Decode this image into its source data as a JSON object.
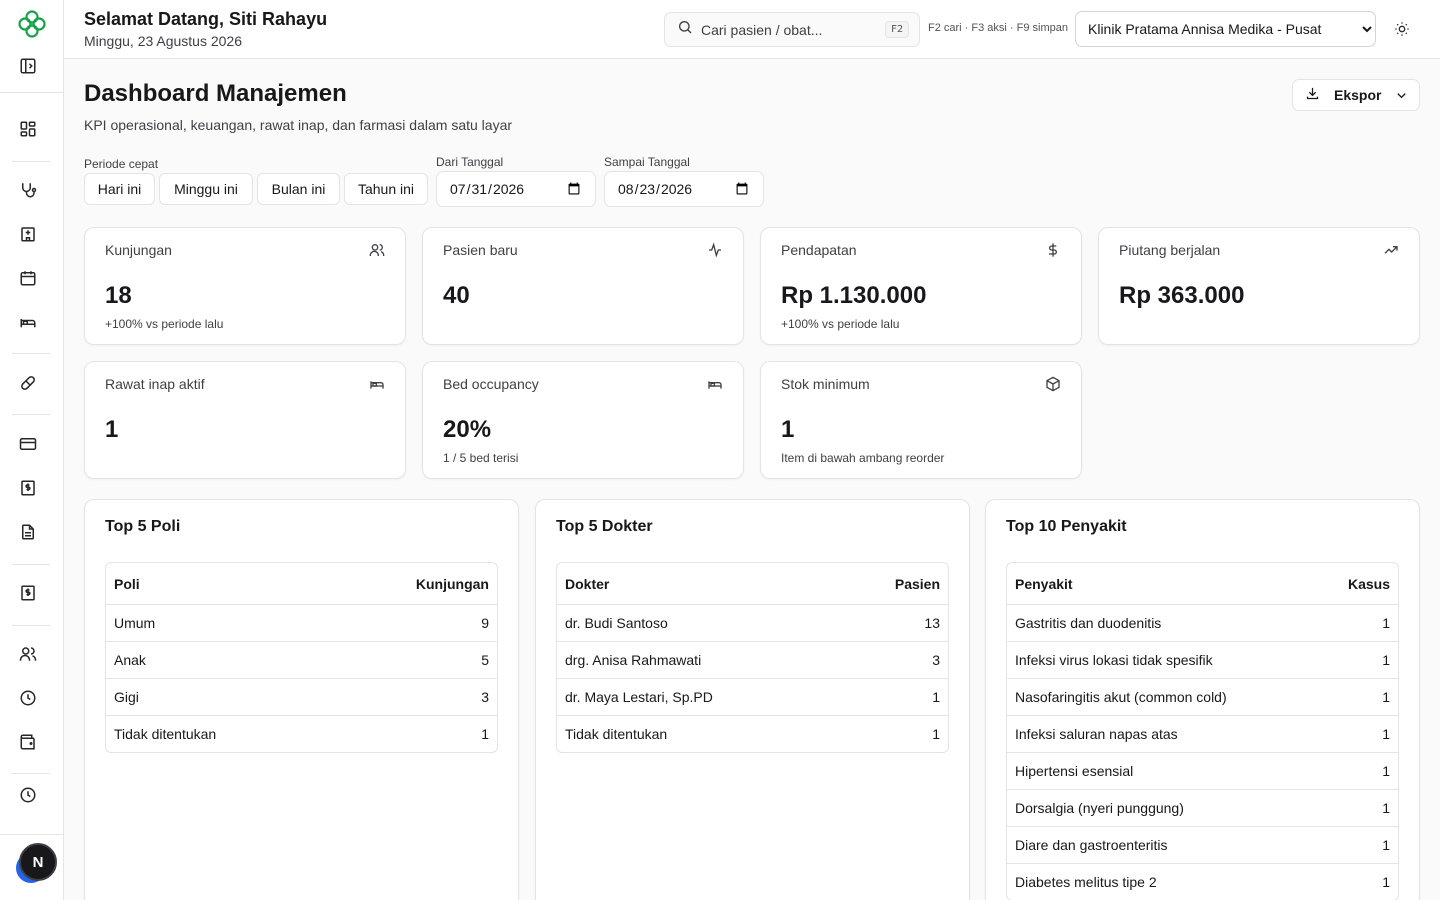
{
  "header": {
    "greeting": "Selamat Datang, Siti Rahayu",
    "date": "Minggu, 23 Agustus 2026",
    "search_placeholder": "Cari pasien / obat...",
    "search_kbd": "F2",
    "shortcuts": "F2 cari · F3 aksi · F9 simpan",
    "clinic_selected": "Klinik Pratama Annisa Medika - Pusat"
  },
  "sidebar": {
    "avatar_letter": "N",
    "icons": [
      "logo-icon",
      "sidebar-toggle-icon",
      "dashboard-icon",
      "stethoscope-icon",
      "hospital-icon",
      "calendar-icon",
      "bed-icon",
      "pill-icon",
      "credit-card-icon",
      "receipt-icon",
      "file-text-icon",
      "dollar-receipt-icon",
      "users-icon",
      "clock-icon",
      "wallet-icon",
      "history-icon"
    ]
  },
  "page": {
    "title": "Dashboard Manajemen",
    "subtitle": "KPI operasional, keuangan, rawat inap, dan farmasi dalam satu layar",
    "export_label": "Ekspor"
  },
  "filters": {
    "quick_label": "Periode cepat",
    "quick": [
      "Hari ini",
      "Minggu ini",
      "Bulan ini",
      "Tahun ini"
    ],
    "from_label": "Dari Tanggal",
    "from_value": "2026-07-31",
    "to_label": "Sampai Tanggal",
    "to_value": "2026-08-23"
  },
  "kpis": [
    {
      "title": "Kunjungan",
      "value": "18",
      "sub": "+100% vs periode lalu",
      "icon": "users-icon"
    },
    {
      "title": "Pasien baru",
      "value": "40",
      "sub": "",
      "icon": "activity-icon"
    },
    {
      "title": "Pendapatan",
      "value": "Rp 1.130.000",
      "sub": "+100% vs periode lalu",
      "icon": "dollar-icon"
    },
    {
      "title": "Piutang berjalan",
      "value": "Rp 363.000",
      "sub": "",
      "icon": "trending-up-icon"
    },
    {
      "title": "Rawat inap aktif",
      "value": "1",
      "sub": "",
      "icon": "bed-icon"
    },
    {
      "title": "Bed occupancy",
      "value": "20%",
      "sub": "1 / 5 bed terisi",
      "icon": "bed-icon"
    },
    {
      "title": "Stok minimum",
      "value": "1",
      "sub": "Item di bawah ambang reorder",
      "icon": "package-icon"
    }
  ],
  "panels": {
    "poli": {
      "title": "Top 5 Poli",
      "headers": [
        "Poli",
        "Kunjungan"
      ],
      "rows": [
        [
          "Umum",
          "9"
        ],
        [
          "Anak",
          "5"
        ],
        [
          "Gigi",
          "3"
        ],
        [
          "Tidak ditentukan",
          "1"
        ]
      ]
    },
    "dokter": {
      "title": "Top 5 Dokter",
      "headers": [
        "Dokter",
        "Pasien"
      ],
      "rows": [
        [
          "dr. Budi Santoso",
          "13"
        ],
        [
          "drg. Anisa Rahmawati",
          "3"
        ],
        [
          "dr. Maya Lestari, Sp.PD",
          "1"
        ],
        [
          "Tidak ditentukan",
          "1"
        ]
      ]
    },
    "penyakit": {
      "title": "Top 10 Penyakit",
      "headers": [
        "Penyakit",
        "Kasus"
      ],
      "rows": [
        [
          "Gastritis dan duodenitis",
          "1"
        ],
        [
          "Infeksi virus lokasi tidak spesifik",
          "1"
        ],
        [
          "Nasofaringitis akut (common cold)",
          "1"
        ],
        [
          "Infeksi saluran napas atas",
          "1"
        ],
        [
          "Hipertensi esensial",
          "1"
        ],
        [
          "Dorsalgia (nyeri punggung)",
          "1"
        ],
        [
          "Diare dan gastroenteritis",
          "1"
        ],
        [
          "Diabetes melitus tipe 2",
          "1"
        ]
      ]
    }
  },
  "colors": {
    "brand": "#16a34a",
    "text": "#18181b",
    "muted": "#3f3f46",
    "border": "#e4e4e7",
    "avatar_bg": "#18181b"
  }
}
